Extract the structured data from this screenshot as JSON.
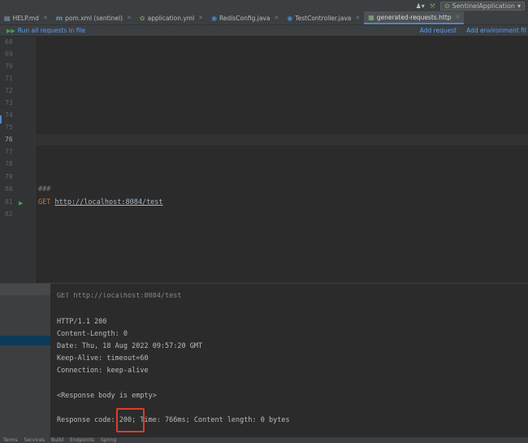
{
  "top_right": {
    "user_icon": "user-icon",
    "hammer_icon": "hammer-icon",
    "run_config": "SentinelApplication"
  },
  "tabs": [
    {
      "label": "HELP.md",
      "icon": "markdown-icon",
      "active": false
    },
    {
      "label": "pom.xml (sentinel)",
      "icon": "maven-icon",
      "active": false
    },
    {
      "label": "application.yml",
      "icon": "yaml-icon",
      "active": false
    },
    {
      "label": "RedisConfig.java",
      "icon": "java-class-icon",
      "active": false
    },
    {
      "label": "TestController.java",
      "icon": "java-class-icon",
      "active": false
    },
    {
      "label": "generated-requests.http",
      "icon": "http-file-icon",
      "active": true
    }
  ],
  "runbar": {
    "run_all": "Run all requests in file",
    "add_request": "Add request",
    "add_environment": "Add environment fil"
  },
  "editor": {
    "line_numbers": [
      "68",
      "69",
      "70",
      "71",
      "72",
      "73",
      "74",
      "75",
      "76",
      "77",
      "78",
      "79",
      "80",
      "81",
      "82"
    ],
    "current_line": "76",
    "separator": "###",
    "method": "GET",
    "url": "http://localhost:8084/test"
  },
  "response": {
    "request_line": "GET http://localhost:8084/test",
    "lines": [
      "HTTP/1.1 200",
      "Content-Length: 0",
      "Date: Thu, 18 Aug 2022 09:57:20 GMT",
      "Keep-Alive: timeout=60",
      "Connection: keep-alive",
      "",
      "<Response body is empty>",
      "",
      "Response code: 200; Time: 766ms; Content length: 0 bytes"
    ]
  },
  "status_bar": [
    "Terms",
    "Services",
    "Build",
    "Endpoints",
    "Spring"
  ]
}
